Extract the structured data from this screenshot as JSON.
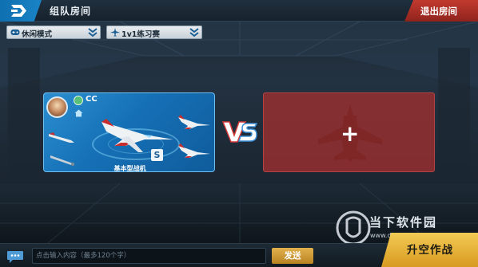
{
  "header": {
    "title": "组队房间",
    "exit_label": "退出房间"
  },
  "filters": {
    "mode_label": "休闲模式",
    "match_label": "1v1练习赛"
  },
  "player": {
    "name": "CC",
    "plane_name": "基本型战机",
    "skin_label": "S"
  },
  "empty_slot": {
    "add_label": "+"
  },
  "watermark": {
    "text": "当下软件园",
    "url": "www.downxia.com"
  },
  "chat": {
    "placeholder": "点击输入内容（最多120个字）",
    "send_label": "发送"
  },
  "actions": {
    "battle_label": "升空作战"
  },
  "colors": {
    "card_blue": "#1670b6",
    "slot_red": "#a03030",
    "accent_gold": "#e1b14e",
    "exit_red": "#c23a2f"
  }
}
